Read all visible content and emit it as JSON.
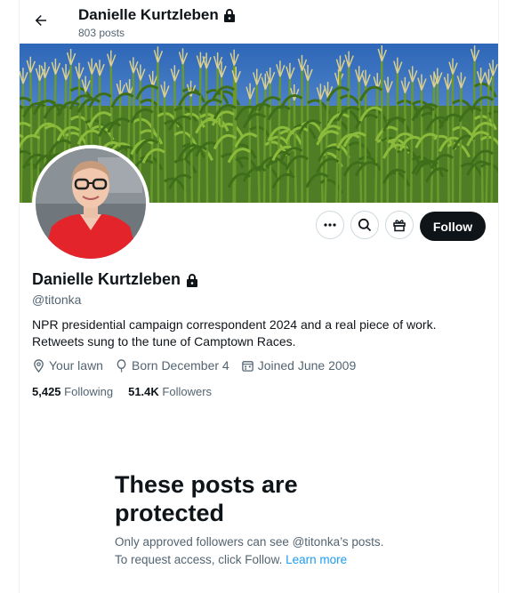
{
  "header": {
    "name": "Danielle Kurtzleben",
    "posts": "803 posts",
    "back_icon": "arrow-left-icon",
    "lock_icon": "lock-icon"
  },
  "actions": {
    "more_icon": "more-icon",
    "search_icon": "search-icon",
    "gift_icon": "gift-icon",
    "follow_label": "Follow"
  },
  "profile": {
    "name": "Danielle Kurtzleben",
    "handle": "@titonka",
    "bio_line1": "NPR presidential campaign correspondent 2024 and a real piece of work.",
    "bio_line2": "Retweets sung to the tune of Camptown Races.",
    "location": "Your lawn",
    "birthday": "Born December 4",
    "joined": "Joined June 2009",
    "following_count": "5,425",
    "following_label": "Following",
    "followers_count": "51.4K",
    "followers_label": "Followers"
  },
  "protected": {
    "title_line1": "These posts are",
    "title_line2": "protected",
    "desc_line1": "Only approved followers can see @titonka’s posts.",
    "desc_line2": "To request access, click Follow.",
    "learn_more": "Learn more"
  },
  "colors": {
    "text": "#0f1419",
    "secondary": "#536471",
    "link": "#1d9bf0",
    "follow_bg": "#0f1419"
  }
}
